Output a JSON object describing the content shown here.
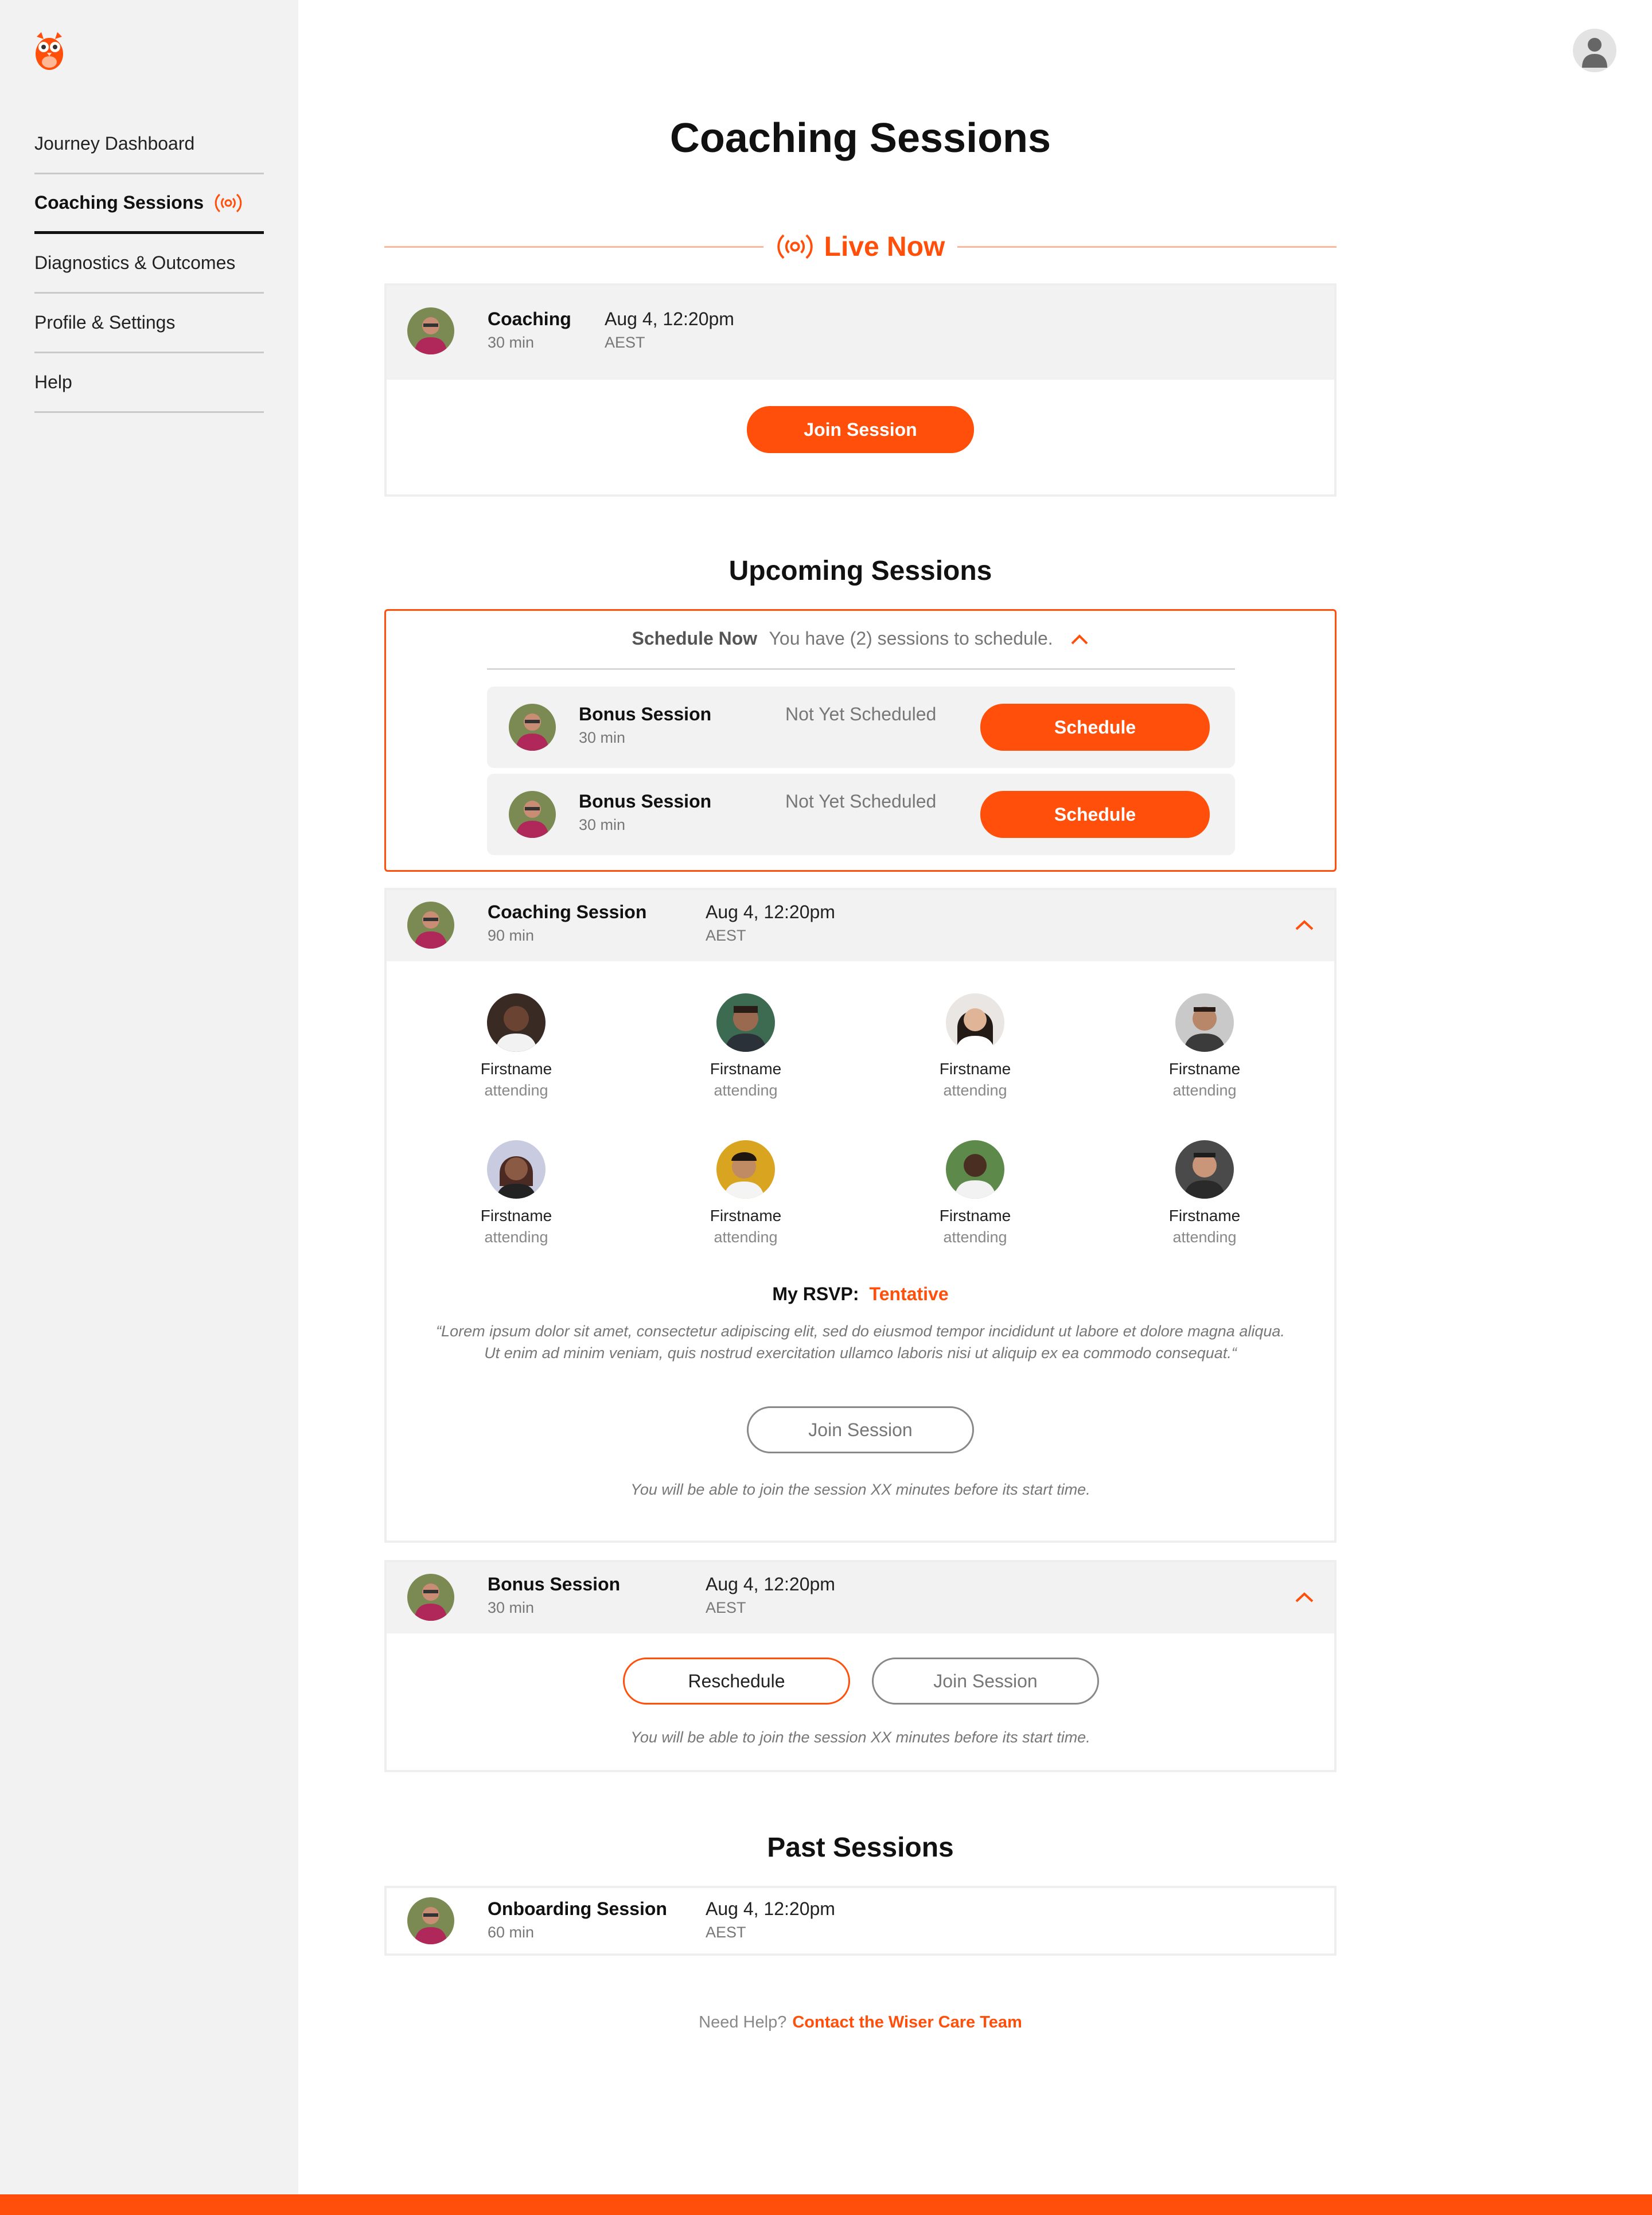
{
  "colors": {
    "accent": "#ff4f0a",
    "sidebar_bg": "#f2f2f2",
    "card_head_bg": "#f2f2f2"
  },
  "sidebar": {
    "logo_icon": "owl-logo-icon",
    "items": [
      {
        "label": "Journey Dashboard",
        "active": false
      },
      {
        "label": "Coaching Sessions",
        "active": true,
        "icon": "live-broadcast-icon"
      },
      {
        "label": "Diagnostics & Outcomes",
        "active": false
      },
      {
        "label": "Profile & Settings",
        "active": false
      },
      {
        "label": "Help",
        "active": false
      }
    ]
  },
  "header": {
    "avatar_icon": "user-avatar-icon"
  },
  "page": {
    "title": "Coaching Sessions"
  },
  "live": {
    "heading": "Live Now",
    "session": {
      "title": "Coaching",
      "duration": "30 min",
      "date": "Aug 4, 12:20pm",
      "tz": "AEST"
    },
    "join_label": "Join Session"
  },
  "upcoming": {
    "heading": "Upcoming Sessions",
    "schedule_now": {
      "label": "Schedule Now",
      "message": "You have (2) sessions to schedule.",
      "rows": [
        {
          "title": "Bonus Session",
          "duration": "30 min",
          "status": "Not Yet Scheduled",
          "button": "Schedule"
        },
        {
          "title": "Bonus Session",
          "duration": "30 min",
          "status": "Not Yet Scheduled",
          "button": "Schedule"
        }
      ]
    },
    "coaching": {
      "title": "Coaching Session",
      "duration": "90 min",
      "date": "Aug 4, 12:20pm",
      "tz": "AEST",
      "attendees": [
        {
          "name": "Firstname",
          "status": "attending"
        },
        {
          "name": "Firstname",
          "status": "attending"
        },
        {
          "name": "Firstname",
          "status": "attending"
        },
        {
          "name": "Firstname",
          "status": "attending"
        },
        {
          "name": "Firstname",
          "status": "attending"
        },
        {
          "name": "Firstname",
          "status": "attending"
        },
        {
          "name": "Firstname",
          "status": "attending"
        },
        {
          "name": "Firstname",
          "status": "attending"
        }
      ],
      "rsvp_label": "My RSVP:",
      "rsvp_value": "Tentative",
      "quote_line1": "“Lorem ipsum dolor sit amet, consectetur adipiscing elit, sed do eiusmod tempor incididunt ut labore et dolore magna aliqua.",
      "quote_line2": "Ut enim ad minim veniam, quis nostrud exercitation ullamco laboris nisi ut aliquip ex ea commodo consequat.“",
      "join_label": "Join Session",
      "note": "You will be able to join the session XX minutes before its start time."
    },
    "bonus": {
      "title": "Bonus Session",
      "duration": "30 min",
      "date": "Aug 4, 12:20pm",
      "tz": "AEST",
      "reschedule_label": "Reschedule",
      "join_label": "Join Session",
      "note": "You will be able to join the session XX minutes before its start time."
    }
  },
  "past": {
    "heading": "Past Sessions",
    "session": {
      "title": "Onboarding Session",
      "duration": "60 min",
      "date": "Aug 4, 12:20pm",
      "tz": "AEST"
    }
  },
  "footer": {
    "help_text": "Need Help?",
    "link_text": "Contact the Wiser Care Team"
  }
}
